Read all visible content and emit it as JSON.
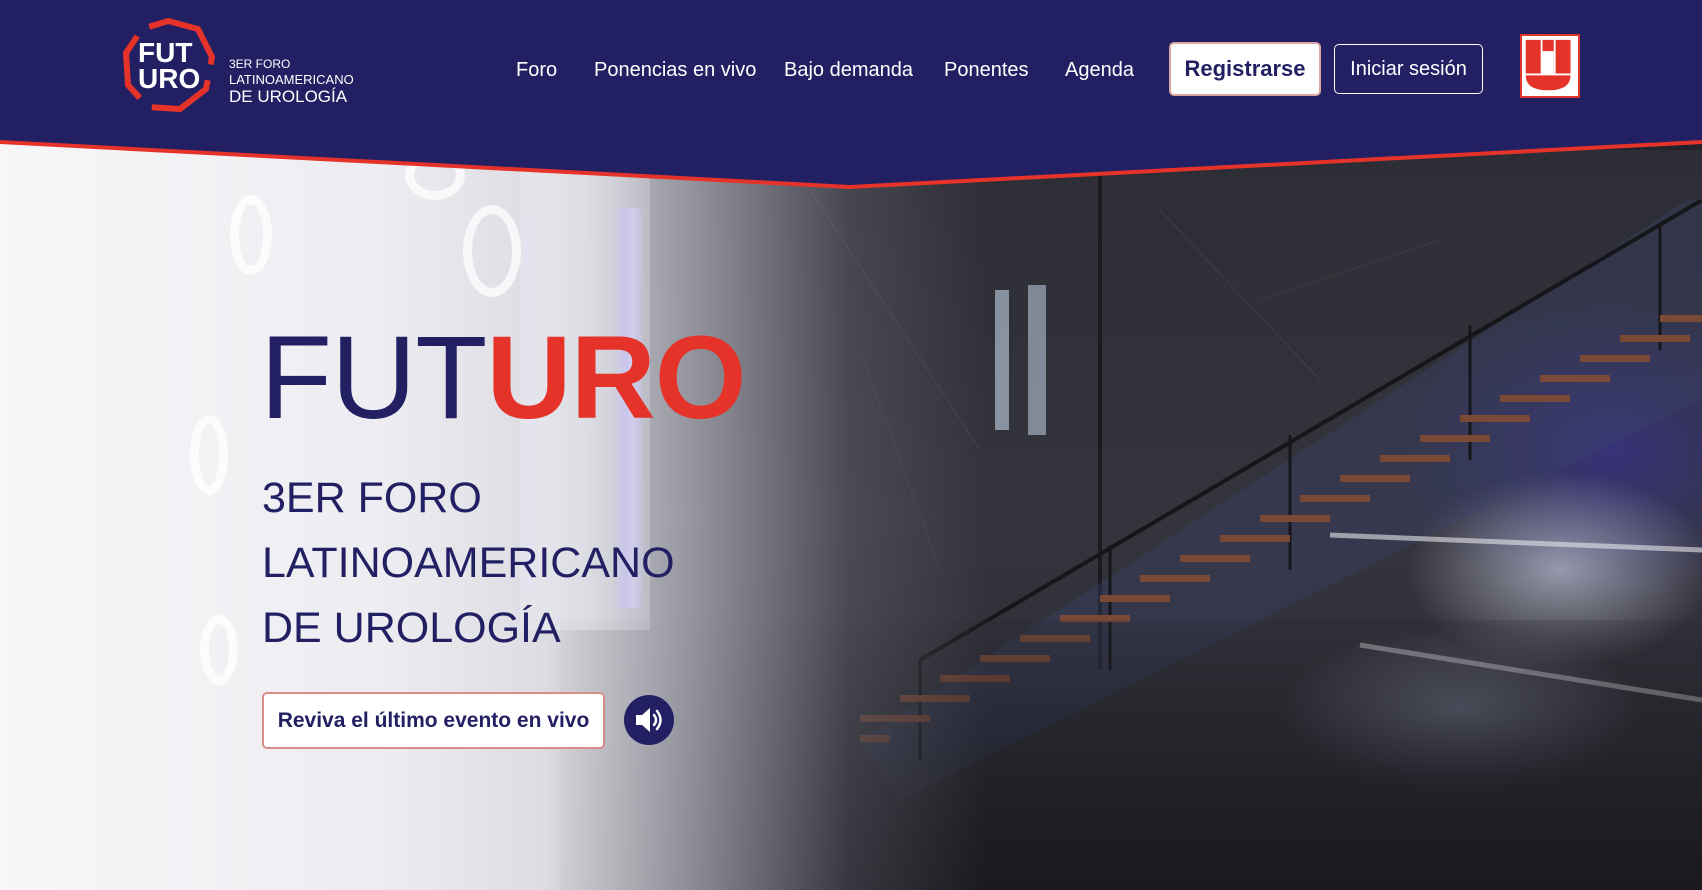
{
  "brand": {
    "logo_line1": "FUT",
    "logo_line2": "URO",
    "logo_sub1": "3ER FORO",
    "logo_sub2": "LATINOAMERICANO",
    "logo_sub3": "DE UROLOGÍA",
    "accent_color": "#e5332a",
    "navy_color": "#221f63"
  },
  "nav": {
    "items": [
      {
        "label": "Foro"
      },
      {
        "label": "Ponencias en vivo"
      },
      {
        "label": "Bajo demanda"
      },
      {
        "label": "Ponentes"
      },
      {
        "label": "Agenda"
      }
    ],
    "register_label": "Registrarse",
    "login_label": "Iniciar sesión",
    "partner_icon": "partner-brand-logo"
  },
  "hero": {
    "title_part1": "FUT",
    "title_part2": "URO",
    "subtitle_lines": [
      "3ER FORO",
      "LATINOAMERICANO",
      "DE UROLOGÍA"
    ],
    "cta_label": "Reviva el último evento en vivo",
    "sound_icon": "speaker-icon"
  }
}
